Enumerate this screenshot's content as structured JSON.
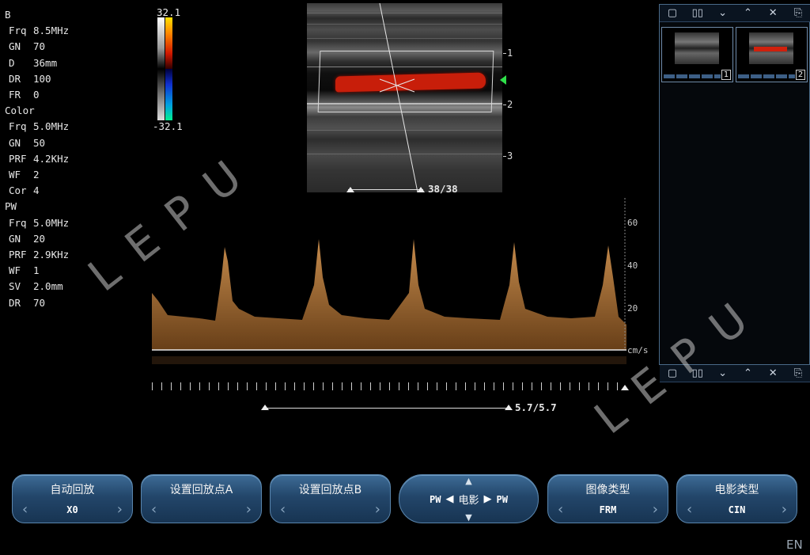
{
  "params": {
    "b": {
      "title": "B",
      "rows": [
        {
          "k": "Frq",
          "v": "8.5MHz"
        },
        {
          "k": "GN",
          "v": "70"
        },
        {
          "k": "D",
          "v": "36mm"
        },
        {
          "k": "DR",
          "v": "100"
        },
        {
          "k": "FR",
          "v": "0"
        }
      ]
    },
    "color": {
      "title": "Color",
      "rows": [
        {
          "k": "Frq",
          "v": "5.0MHz"
        },
        {
          "k": "GN",
          "v": "50"
        },
        {
          "k": "PRF",
          "v": "4.2KHz"
        },
        {
          "k": "WF",
          "v": "2"
        },
        {
          "k": "Cor",
          "v": "4"
        }
      ]
    },
    "pw": {
      "title": "PW",
      "rows": [
        {
          "k": "Frq",
          "v": "5.0MHz"
        },
        {
          "k": "GN",
          "v": "20"
        },
        {
          "k": "PRF",
          "v": "2.9KHz"
        },
        {
          "k": "WF",
          "v": "1"
        },
        {
          "k": "SV",
          "v": "2.0mm"
        },
        {
          "k": "DR",
          "v": "70"
        }
      ]
    }
  },
  "colorbar": {
    "top": "32.1",
    "bottom": "-32.1"
  },
  "depth_scale": {
    "labels": [
      "1",
      "2",
      "3"
    ]
  },
  "frame_counter": "38/38",
  "velocity_scale": {
    "labels": [
      "60",
      "40",
      "20"
    ],
    "unit": "cm/s"
  },
  "sweep_counter": "5.7/5.7",
  "watermark": "LEPU",
  "thumbnails": [
    {
      "index": "1"
    },
    {
      "index": "2"
    }
  ],
  "toolbar_icons": [
    "single-view-icon",
    "dual-view-icon",
    "collapse-down-icon",
    "collapse-up-icon",
    "close-icon",
    "export-icon"
  ],
  "controls": {
    "auto_replay": {
      "title": "自动回放",
      "value": "X0"
    },
    "set_point_a": {
      "title": "设置回放点A",
      "value": ""
    },
    "set_point_b": {
      "title": "设置回放点B",
      "value": ""
    },
    "cine": {
      "left": "PW",
      "center": "电影",
      "right": "PW"
    },
    "image_type": {
      "title": "图像类型",
      "value": "FRM"
    },
    "cine_type": {
      "title": "电影类型",
      "value": "CIN"
    }
  },
  "language": "EN",
  "colors": {
    "flow": "#c81e0a",
    "spectrum": "#c8843c",
    "button": "#23466a",
    "accent": "#2fe04a"
  }
}
